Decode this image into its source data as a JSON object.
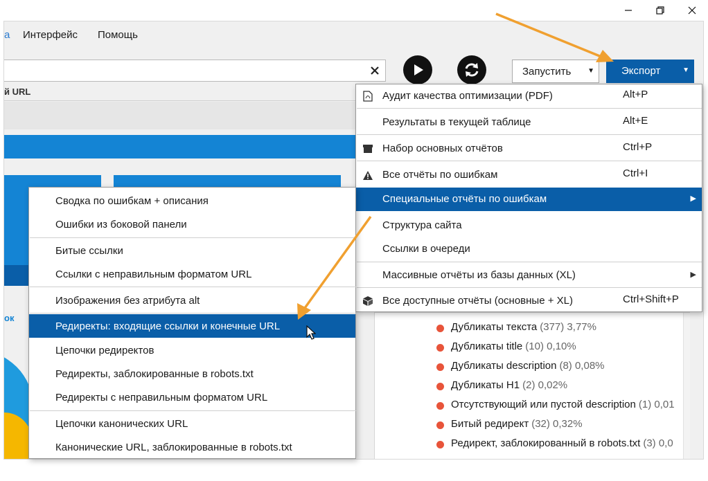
{
  "menubar": {
    "cut_item": "а",
    "interface": "Интерфейс",
    "help": "Помощь"
  },
  "toolbar": {
    "url_value": "",
    "run_label": "Запустить",
    "export_label": "Экспорт"
  },
  "workspace": {
    "url_column_label": "й URL",
    "ok_label": "ок"
  },
  "export_menu": {
    "items": [
      {
        "label": "Аудит качества оптимизации (PDF)",
        "shortcut": "Alt+P",
        "icon": "pdf-icon"
      },
      {
        "label": "Результаты в текущей таблице",
        "shortcut": "Alt+E",
        "icon": ""
      },
      {
        "label": "Набор основных отчётов",
        "shortcut": "Ctrl+P",
        "icon": "archive-icon"
      },
      {
        "label": "Все отчёты по ошибкам",
        "shortcut": "Ctrl+I",
        "icon": "warning-icon"
      },
      {
        "label": "Специальные отчёты по ошибкам",
        "shortcut": "",
        "icon": "",
        "has_submenu": true,
        "active": true
      },
      {
        "label": "Структура сайта",
        "shortcut": "",
        "icon": ""
      },
      {
        "label": "Ссылки в очереди",
        "shortcut": "",
        "icon": ""
      },
      {
        "label": "Массивные отчёты из базы данных (XL)",
        "shortcut": "",
        "icon": "",
        "has_submenu": true
      },
      {
        "label": "Все доступные отчёты (основные + XL)",
        "shortcut": "Ctrl+Shift+P",
        "icon": "box-icon"
      }
    ]
  },
  "special_menu": {
    "items": [
      {
        "label": "Сводка по ошибкам + описания"
      },
      {
        "label": "Ошибки из боковой панели"
      },
      {
        "label": "Битые ссылки"
      },
      {
        "label": "Ссылки с неправильным форматом URL"
      },
      {
        "label": "Изображения без атрибута alt"
      },
      {
        "label": "Редиректы: входящие ссылки и конечные URL",
        "active": true
      },
      {
        "label": "Цепочки редиректов"
      },
      {
        "label": "Редиректы, заблокированные в robots.txt"
      },
      {
        "label": "Редиректы с неправильным форматом URL"
      },
      {
        "label": "Цепочки канонических URL"
      },
      {
        "label": "Канонические URL, заблокированные в robots.txt"
      }
    ]
  },
  "issues_panel": {
    "rows": [
      {
        "label": "Дубликаты текста",
        "count": "(377) 3,77%"
      },
      {
        "label": "Дубликаты title",
        "count": "(10) 0,10%"
      },
      {
        "label": "Дубликаты description",
        "count": "(8) 0,08%"
      },
      {
        "label": "Дубликаты H1",
        "count": "(2) 0,02%"
      },
      {
        "label": "Отсутствующий или пустой description",
        "count": "(1) 0,01"
      },
      {
        "label": "Битый редирект",
        "count": "(32) 0,32%"
      },
      {
        "label": "Редирект, заблокированный в robots.txt",
        "count": "(3) 0,0"
      }
    ],
    "dot_color": "#e8543a"
  },
  "colors": {
    "accent": "#0a5ea8",
    "annotation_arrow": "#f0a030"
  }
}
